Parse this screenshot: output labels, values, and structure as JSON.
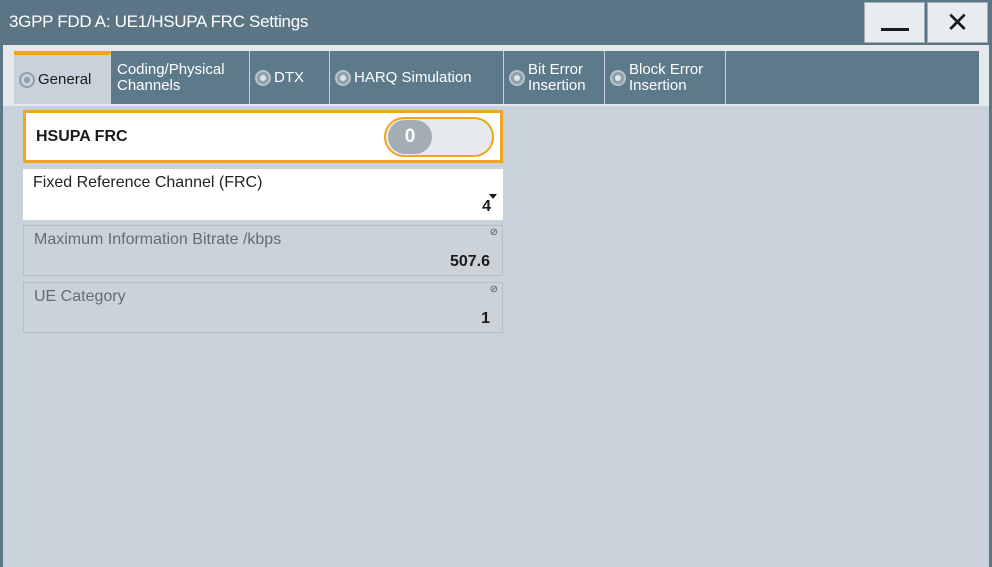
{
  "window": {
    "title": "3GPP FDD A: UE1/HSUPA FRC Settings",
    "minimize_icon": "minimize-icon",
    "close_icon": "close-icon",
    "close_glyph": "✕"
  },
  "tabs": [
    {
      "label": "General",
      "active": true
    },
    {
      "label": "Coding/Physical\nChannels",
      "active": false
    },
    {
      "label": "DTX",
      "active": false
    },
    {
      "label": "HARQ Simulation",
      "active": false
    },
    {
      "label": "Bit Error\nInsertion",
      "active": false
    },
    {
      "label": "Block Error\nInsertion",
      "active": false
    }
  ],
  "fields": {
    "hsupa_frc": {
      "label": "HSUPA FRC",
      "state": "0"
    },
    "frc": {
      "label": "Fixed Reference Channel (FRC)",
      "value": "4"
    },
    "max_bitrate": {
      "label": "Maximum Information Bitrate /kbps",
      "value": "507.6"
    },
    "ue_category": {
      "label": "UE Category",
      "value": "1"
    }
  },
  "colors": {
    "titlebar": "#5b7585",
    "accent": "#f2a31f",
    "background": "#c9d2da"
  }
}
